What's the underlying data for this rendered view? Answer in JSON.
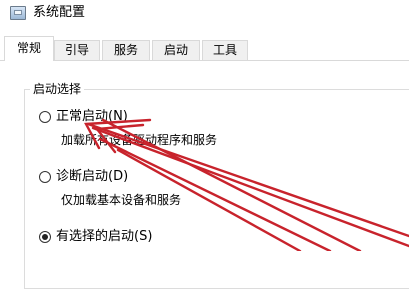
{
  "window": {
    "title": "系统配置"
  },
  "tabs": [
    {
      "label": "常规",
      "active": true
    },
    {
      "label": "引导",
      "active": false
    },
    {
      "label": "服务",
      "active": false
    },
    {
      "label": "启动",
      "active": false
    },
    {
      "label": "工具",
      "active": false
    }
  ],
  "startup_selection": {
    "group_title": "启动选择",
    "options": [
      {
        "label": "正常启动(N)",
        "description": "加载所有设备驱动程序和服务",
        "checked": false
      },
      {
        "label": "诊断启动(D)",
        "description": "仅加载基本设备和服务",
        "checked": false
      },
      {
        "label": "有选择的启动(S)",
        "checked": true
      }
    ]
  },
  "annotation": {
    "arrow_color": "#c8232c"
  }
}
